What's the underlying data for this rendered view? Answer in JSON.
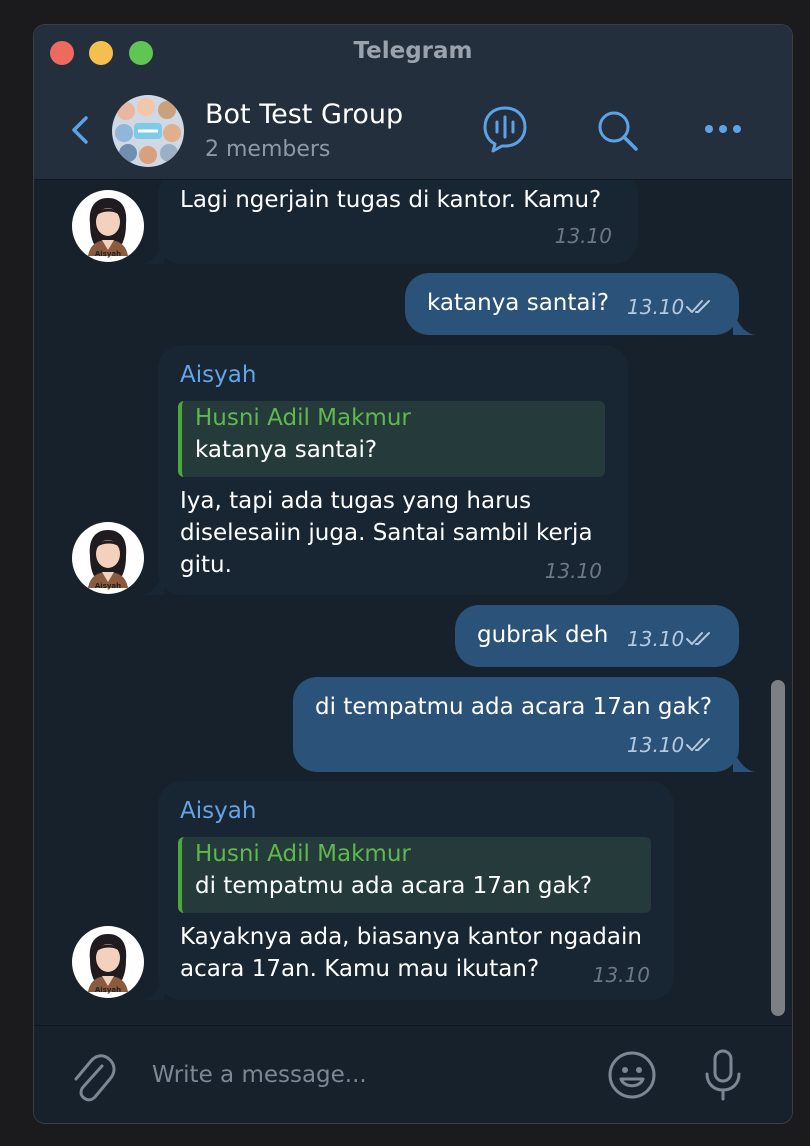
{
  "window": {
    "title": "Telegram"
  },
  "chat": {
    "name": "Bot Test Group",
    "members": "2 members"
  },
  "avatar_caption": "Aisyah",
  "messages": [
    {
      "dir": "in",
      "text": "Lagi ngerjain tugas di kantor. Kamu?",
      "time": "13.10"
    },
    {
      "dir": "out",
      "text": "katanya santai?",
      "time": "13.10",
      "status": "read"
    },
    {
      "dir": "in",
      "sender": "Aisyah",
      "reply_name": "Husni Adil Makmur",
      "reply_text": "katanya santai?",
      "lines": [
        "Iya, tapi ada tugas yang harus",
        "diselesaiin juga. Santai sambil kerja",
        "gitu."
      ],
      "time": "13.10"
    },
    {
      "dir": "out",
      "text": "gubrak deh",
      "time": "13.10",
      "status": "read"
    },
    {
      "dir": "out",
      "text": "di tempatmu ada acara 17an gak?",
      "time": "13.10",
      "status": "read"
    },
    {
      "dir": "in",
      "sender": "Aisyah",
      "reply_name": "Husni Adil Makmur",
      "reply_text": "di tempatmu ada acara 17an gak?",
      "lines": [
        "Kayaknya ada, biasanya kantor ngadain",
        "acara 17an. Kamu mau ikutan?"
      ],
      "time": "13.10"
    }
  ],
  "composer": {
    "placeholder": "Write a message..."
  },
  "icons": {
    "back": "chevron-left-icon",
    "voice_chat": "voice-chat-icon",
    "search": "search-icon",
    "more": "more-icon",
    "attach": "paperclip-icon",
    "emoji": "emoji-icon",
    "mic": "microphone-icon",
    "read": "double-check-icon"
  },
  "colors": {
    "accent": "#64a5e8",
    "incoming": "#182533",
    "outgoing": "#2b5278",
    "reply_bar": "#4ca839",
    "background": "#17212b"
  }
}
